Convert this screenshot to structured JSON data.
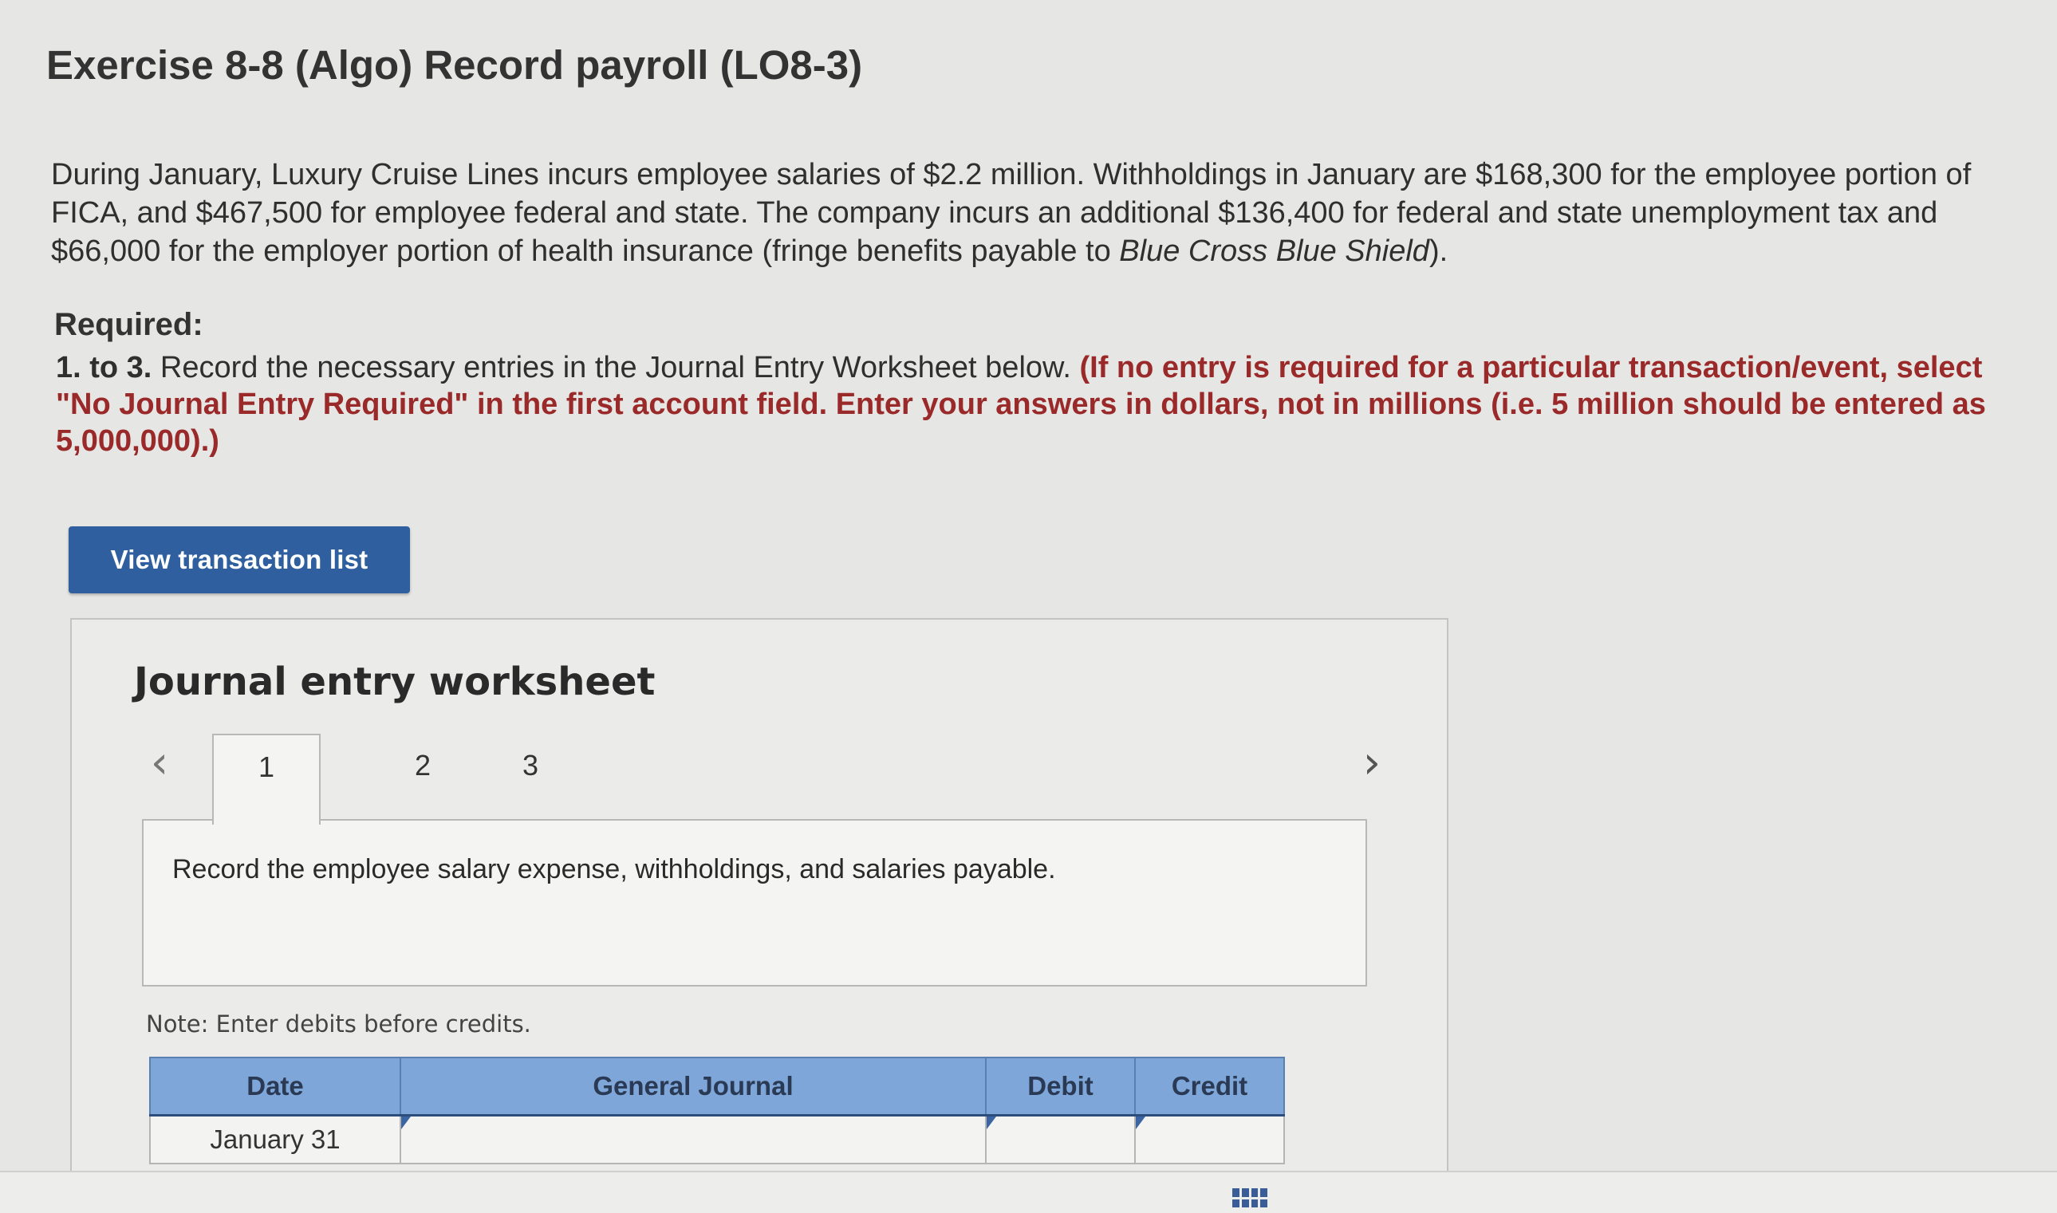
{
  "header": {
    "title": "Exercise 8-8 (Algo) Record payroll (LO8-3)"
  },
  "problem": {
    "text_before": "During January, Luxury Cruise Lines incurs employee salaries of $2.2 million. Withholdings in January are $168,300 for the employee portion of FICA, and $467,500 for employee federal and state. The company incurs an additional $136,400 for federal and state unemployment tax and $66,000 for the employer portion of health insurance (fringe benefits payable to ",
    "company_italic": "Blue Cross Blue Shield",
    "text_after": ")."
  },
  "required": {
    "heading": "Required:",
    "lead": "1. to 3.",
    "text": " Record the necessary entries in the Journal Entry Worksheet below. ",
    "note": "(If no entry is required for a particular transaction/event, select \"No Journal Entry Required\" in the first account field. Enter your answers in dollars, not in millions (i.e. 5 million should be entered as 5,000,000).)"
  },
  "buttons": {
    "view_transactions": "View transaction list"
  },
  "worksheet": {
    "title": "Journal entry worksheet",
    "tabs": [
      "1",
      "2",
      "3"
    ],
    "active_tab": "1",
    "instruction": "Record the employee salary expense, withholdings, and salaries payable.",
    "note": "Note: Enter debits before credits.",
    "columns": {
      "date": "Date",
      "general_journal": "General Journal",
      "debit": "Debit",
      "credit": "Credit"
    },
    "rows": [
      {
        "date": "January 31",
        "account": "",
        "debit": "",
        "credit": ""
      }
    ]
  },
  "icons": {
    "prev": "chevron-left-icon",
    "next": "chevron-right-icon",
    "grid": "grid-icon"
  },
  "colors": {
    "button_blue": "#2f5f9e",
    "table_header_blue": "#7fa6d8",
    "instruction_red": "#9a2a2a"
  }
}
